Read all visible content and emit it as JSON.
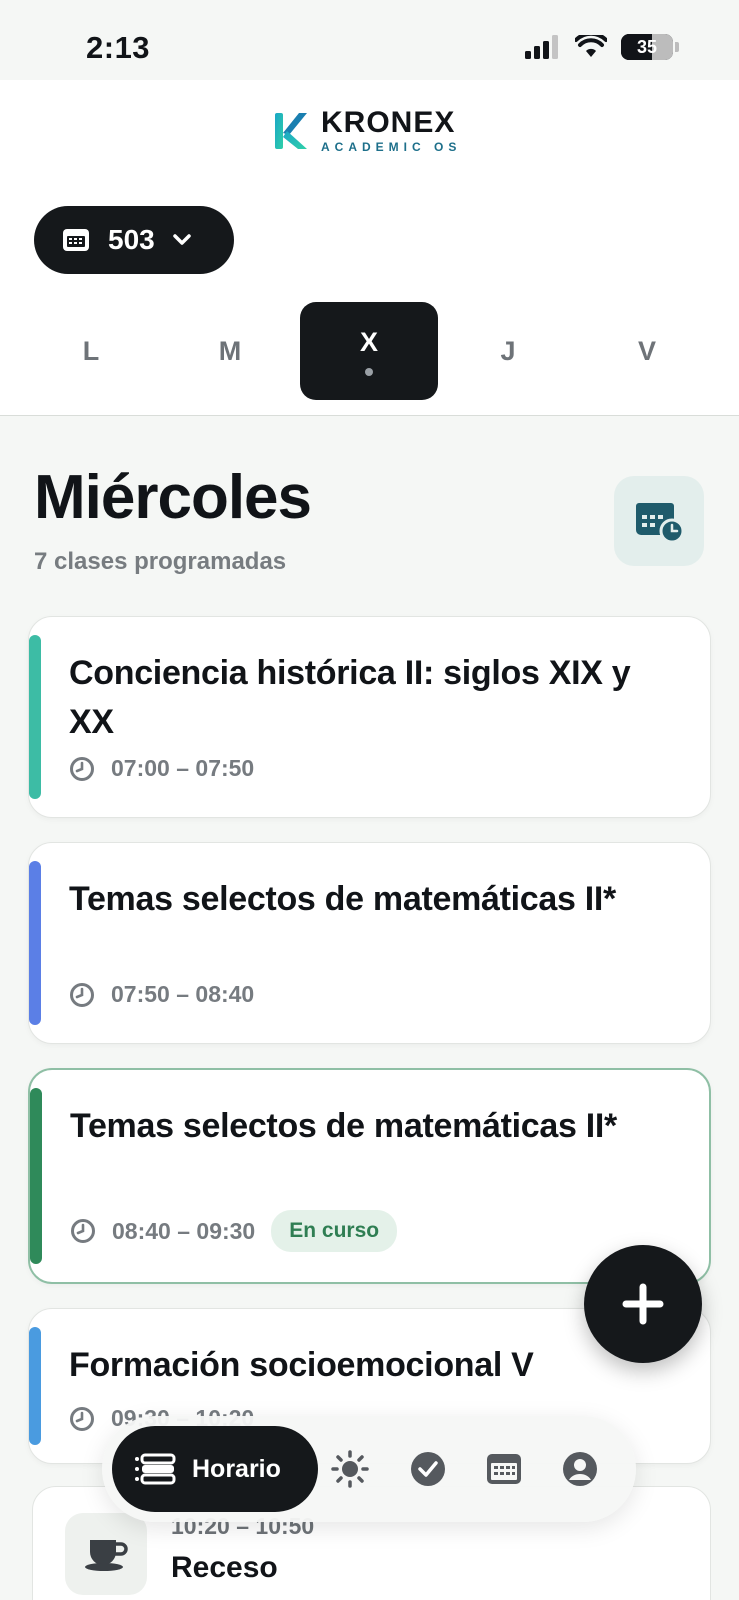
{
  "status": {
    "time": "2:13",
    "battery": "35"
  },
  "brand": {
    "name": "KRONEX",
    "tagline": "ACADEMIC OS"
  },
  "group": {
    "label": "503"
  },
  "days": [
    {
      "label": "L"
    },
    {
      "label": "M"
    },
    {
      "label": "X"
    },
    {
      "label": "J"
    },
    {
      "label": "V"
    }
  ],
  "day_view": {
    "title": "Miércoles",
    "subtitle": "7 clases programadas"
  },
  "classes": [
    {
      "title": "Conciencia histórica II: siglos XIX y XX",
      "time": "07:00 – 07:50",
      "color": "#3dbca5"
    },
    {
      "title": "Temas selectos de matemáticas II*",
      "time": "07:50 – 08:40",
      "color": "#5b7fe6"
    },
    {
      "title": "Temas selectos de matemáticas II*",
      "time": "08:40 – 09:30",
      "color": "#2f8a5a",
      "badge": "En curso"
    },
    {
      "title": "Formación socioemocional V",
      "time": "09:30 – 10:20",
      "color": "#4a9be0"
    }
  ],
  "break": {
    "time": "10:20 – 10:50",
    "title": "Receso"
  },
  "nav": {
    "active_label": "Horario"
  },
  "icons": {
    "signal": "signal-icon",
    "wifi": "wifi-icon",
    "calendar": "calendar-icon",
    "clock": "clock-icon",
    "plus": "plus-icon",
    "coffee": "coffee-icon",
    "sun": "sun-icon",
    "check": "check-circle-icon",
    "grid": "calendar-grid-icon",
    "user": "user-icon"
  }
}
